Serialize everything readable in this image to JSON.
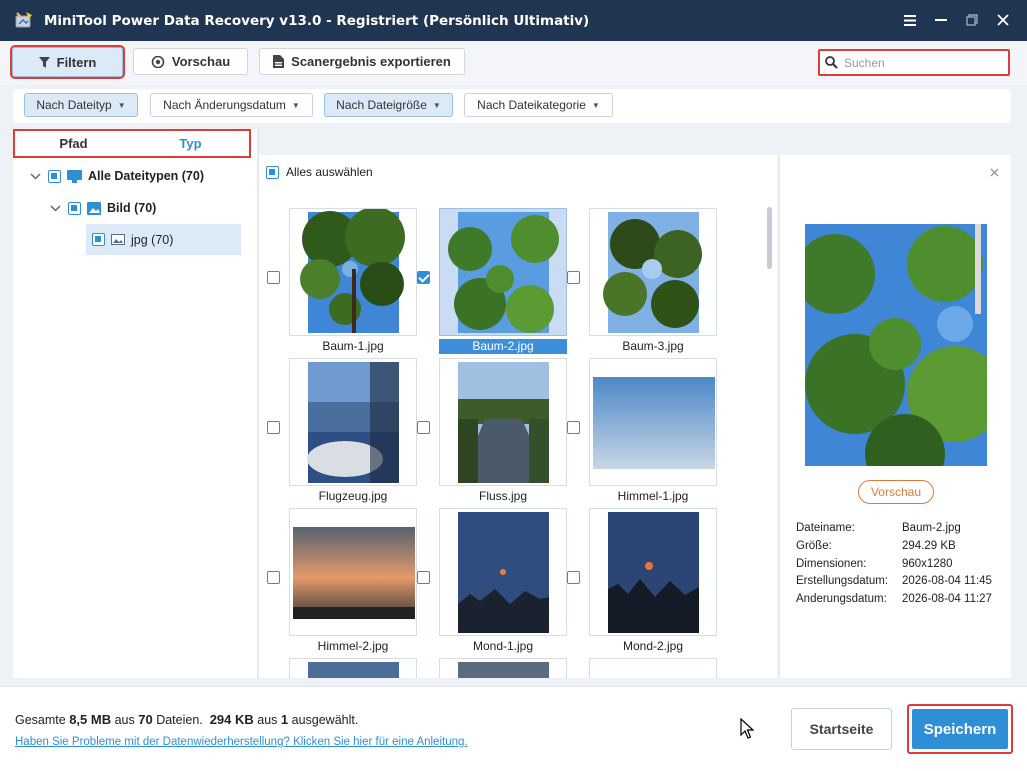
{
  "window": {
    "title": "MiniTool Power Data Recovery v13.0 - Registriert (Persönlich Ultimativ)"
  },
  "toolbar": {
    "filter_label": "Filtern",
    "preview_label": "Vorschau",
    "export_label": "Scanergebnis exportieren",
    "search_placeholder": "Suchen"
  },
  "filters": [
    {
      "label": "Nach Dateityp",
      "active": true
    },
    {
      "label": "Nach Änderungsdatum",
      "active": false
    },
    {
      "label": "Nach Dateigröße",
      "active": true
    },
    {
      "label": "Nach Dateikategorie",
      "active": false
    }
  ],
  "left_panel": {
    "tabs": [
      {
        "label": "Pfad",
        "active": false
      },
      {
        "label": "Typ",
        "active": true
      }
    ],
    "tree": [
      {
        "label": "Alle Dateitypen (70)",
        "icon": "monitor-icon"
      },
      {
        "label": "Bild (70)",
        "icon": "image-icon"
      },
      {
        "label": "jpg (70)",
        "icon": "jpg-file-icon"
      }
    ]
  },
  "grid": {
    "select_all_label": "Alles auswählen",
    "files": [
      {
        "name": "Baum-1.jpg",
        "checked": false,
        "selected": false,
        "kind": "tree"
      },
      {
        "name": "Baum-2.jpg",
        "checked": true,
        "selected": true,
        "kind": "tree2"
      },
      {
        "name": "Baum-3.jpg",
        "checked": false,
        "selected": false,
        "kind": "tree3"
      },
      {
        "name": "Flugzeug.jpg",
        "checked": false,
        "selected": false,
        "kind": "plane"
      },
      {
        "name": "Fluss.jpg",
        "checked": false,
        "selected": false,
        "kind": "river"
      },
      {
        "name": "Himmel-1.jpg",
        "checked": false,
        "selected": false,
        "kind": "sky"
      },
      {
        "name": "Himmel-2.jpg",
        "checked": false,
        "selected": false,
        "kind": "sunset"
      },
      {
        "name": "Mond-1.jpg",
        "checked": false,
        "selected": false,
        "kind": "moon"
      },
      {
        "name": "Mond-2.jpg",
        "checked": false,
        "selected": false,
        "kind": "moon2"
      }
    ]
  },
  "preview_panel": {
    "button_label": "Vorschau",
    "info": [
      {
        "key": "Dateiname:",
        "value": "Baum-2.jpg"
      },
      {
        "key": "Größe:",
        "value": "294.29 KB"
      },
      {
        "key": "Dimensionen:",
        "value": "960x1280"
      },
      {
        "key": "Erstellungsdatum:",
        "value": "2026-08-04 11:45"
      },
      {
        "key": "Änderungsdatum:",
        "value": "2026-08-04 11:27"
      }
    ]
  },
  "footer": {
    "summary_prefix": "Gesamte",
    "total_size": "8,5 MB",
    "summary_mid": "aus",
    "total_files": "70",
    "summary_files": "Dateien.",
    "selected_size": "294 KB",
    "summary_mid2": "aus",
    "selected_count": "1",
    "summary_end": "ausgewählt.",
    "help_link": "Haben Sie Probleme mit der Datenwiederherstellung? Klicken Sie hier für eine Anleitung.",
    "home_label": "Startseite",
    "save_label": "Speichern"
  },
  "colors": {
    "titlebar": "#1f3552",
    "accent": "#2f8fd6",
    "highlight": "#e03b3b",
    "preview_button": "#e07a3a"
  }
}
